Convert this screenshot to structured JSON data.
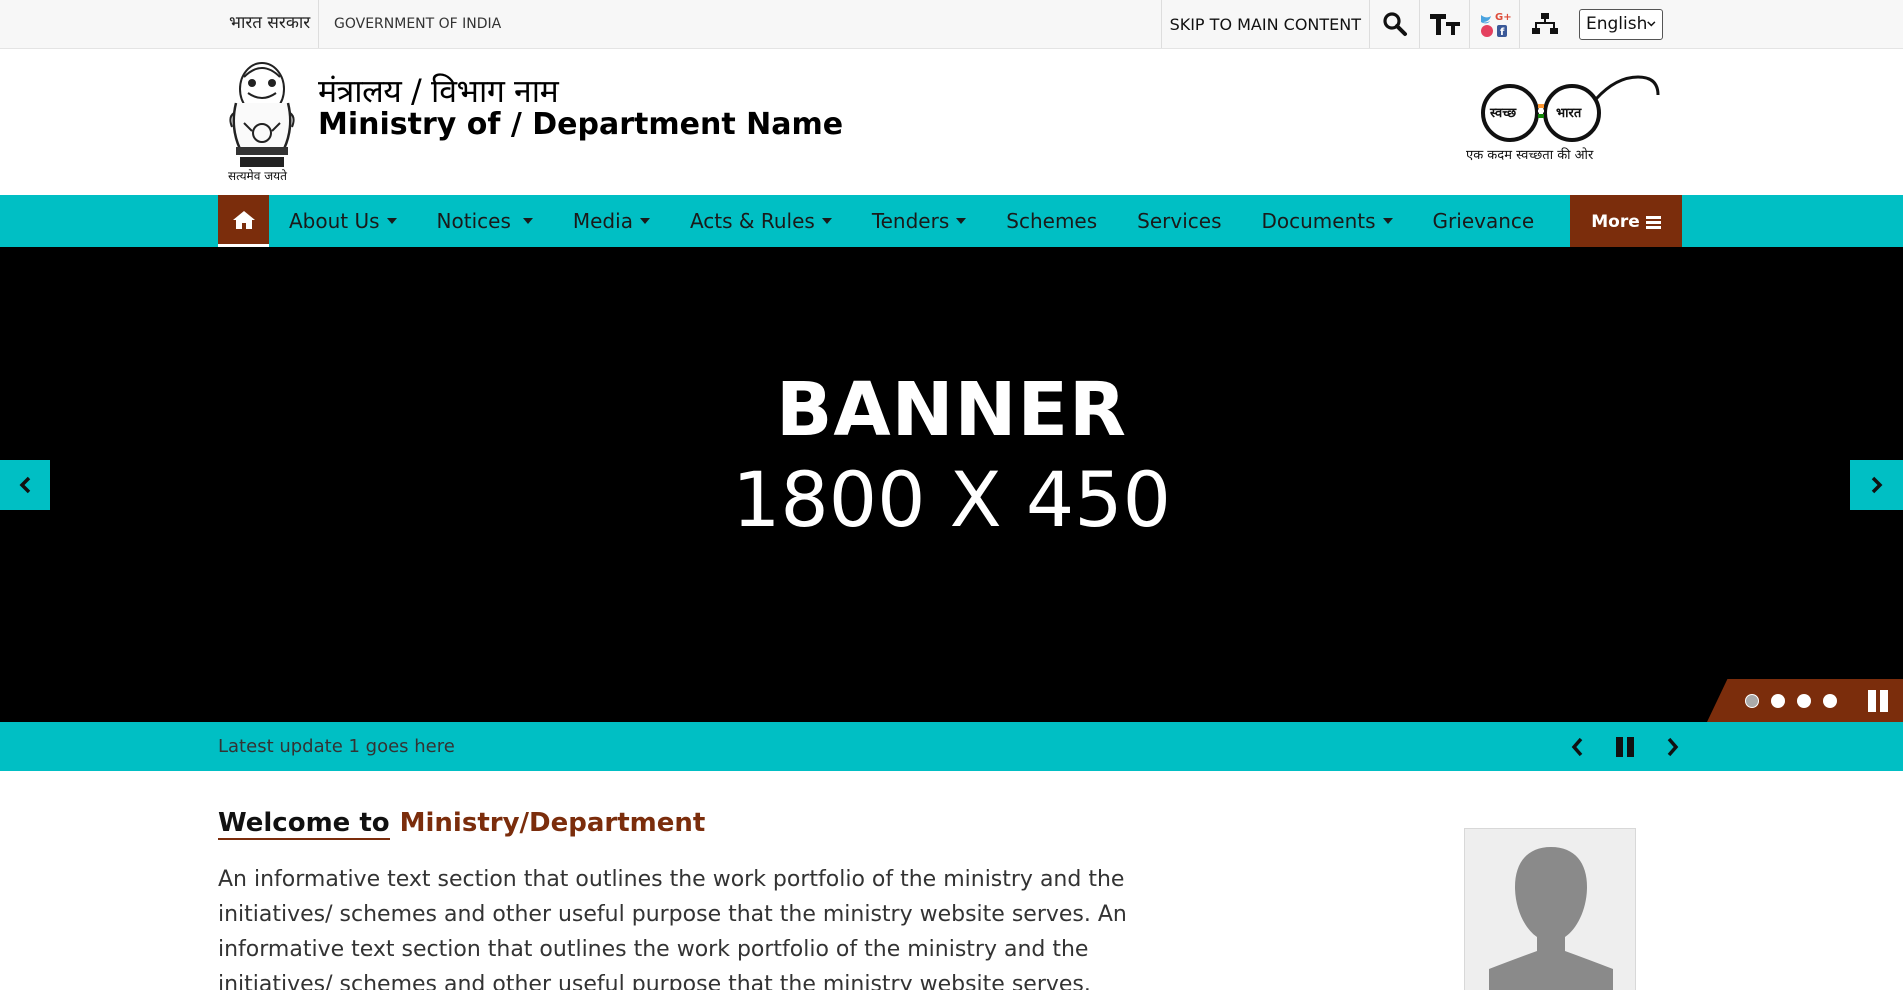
{
  "topbar": {
    "gov_hindi": "भारत सरकार",
    "gov_english": "GOVERNMENT OF INDIA",
    "skip_link": "SKIP TO MAIN CONTENT",
    "language": "English",
    "icons": [
      "search-icon",
      "text-size-icon",
      "social-media-icon",
      "sitemap-icon"
    ]
  },
  "header": {
    "dept_hindi": "मंत्रालय / विभाग नाम",
    "dept_english": "Ministry of / Department Name",
    "emblem_caption": "सत्यमेव जयते",
    "swachh_left": "स्वच्छ",
    "swachh_right": "भारत",
    "swachh_tagline": "एक कदम स्वच्छता की ओर"
  },
  "nav": {
    "items": [
      {
        "label": "About Us",
        "dropdown": true
      },
      {
        "label": "Notices",
        "dropdown": true
      },
      {
        "label": "Media",
        "dropdown": true
      },
      {
        "label": "Acts & Rules",
        "dropdown": true
      },
      {
        "label": "Tenders",
        "dropdown": true
      },
      {
        "label": "Schemes",
        "dropdown": false
      },
      {
        "label": "Services",
        "dropdown": false
      },
      {
        "label": "Documents",
        "dropdown": true
      },
      {
        "label": "Grievance",
        "dropdown": false
      }
    ],
    "more_label": "More"
  },
  "banner": {
    "line1": "BANNER",
    "line2": "1800 X 450",
    "slide_count": 4,
    "active_slide": 1
  },
  "ticker": {
    "text": "Latest update 1 goes here"
  },
  "welcome": {
    "prefix": "Welcome to",
    "ministry": "Ministry/Department",
    "paragraph": "An informative text section that outlines the work portfolio of the ministry and the initiatives/ schemes and other useful purpose that the ministry website serves. An informative text section that outlines the work portfolio of the ministry and the initiatives/ schemes and other useful purpose that the ministry website serves."
  },
  "colors": {
    "accent": "#00bfc4",
    "brand": "#7b2d0c",
    "banner_bg": "#000000"
  }
}
